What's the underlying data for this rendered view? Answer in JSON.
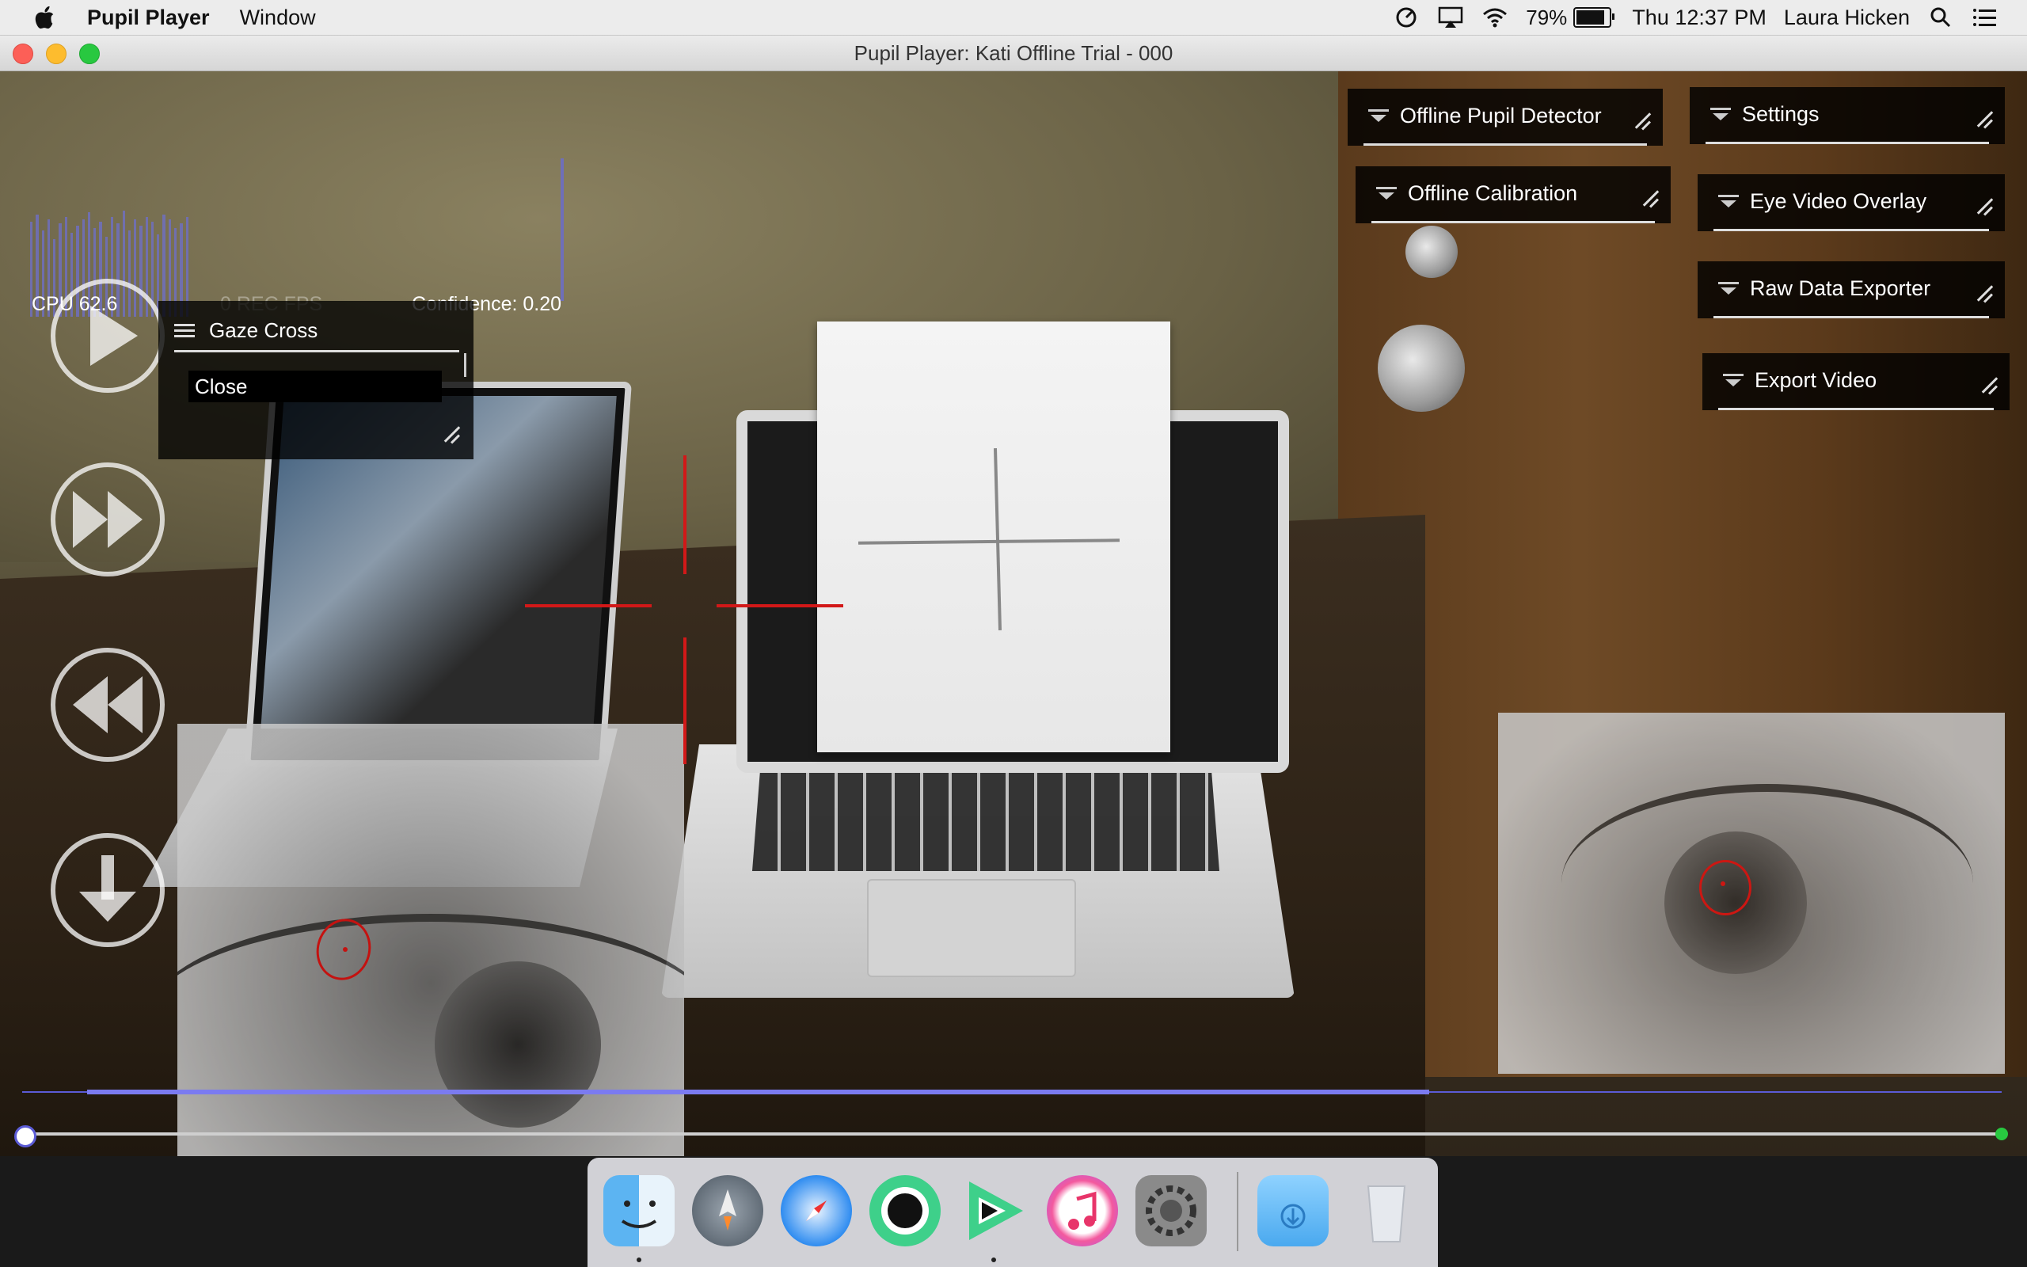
{
  "menubar": {
    "app_name": "Pupil Player",
    "menus": [
      "Window"
    ],
    "battery_percent": "79%",
    "battery_level": 0.79,
    "clock": "Thu 12:37 PM",
    "user": "Laura Hicken",
    "icons": [
      "apple-icon",
      "timer-icon",
      "airplay-icon",
      "wifi-icon",
      "battery-icon",
      "spotlight-search-icon",
      "notification-center-icon"
    ]
  },
  "window": {
    "title": "Pupil Player: Kati Offline Trial - 000"
  },
  "graphs": {
    "cpu_label": "CPU 62.6",
    "fps_label": "0 REC FPS",
    "confidence_label": "Confidence: 0.20",
    "accent_color": "#6f6fb8"
  },
  "gaze_cross_menu": {
    "title": "Gaze Cross",
    "close_label": "Close"
  },
  "plugins": {
    "offline_pupil_detector": "Offline Pupil Detector",
    "offline_calibration": "Offline Calibration",
    "settings": "Settings",
    "eye_video_overlay": "Eye Video Overlay",
    "raw_data_exporter": "Raw Data Exporter",
    "export_video": "Export Video"
  },
  "controls": [
    "play-button",
    "forward-button",
    "rewind-button",
    "download-button"
  ],
  "timeline": {
    "trim_color": "#5b5bd6",
    "playhead_fraction": 0
  },
  "dock": {
    "apps": [
      "Finder",
      "Launchpad",
      "Safari",
      "Pupil Capture",
      "Pupil Player",
      "iTunes",
      "System Preferences",
      "Downloads",
      "Trash"
    ]
  },
  "colors": {
    "gaze_cross": "#d21818",
    "pupil_ellipse": "#e01010",
    "panel_bg": "#000000"
  }
}
